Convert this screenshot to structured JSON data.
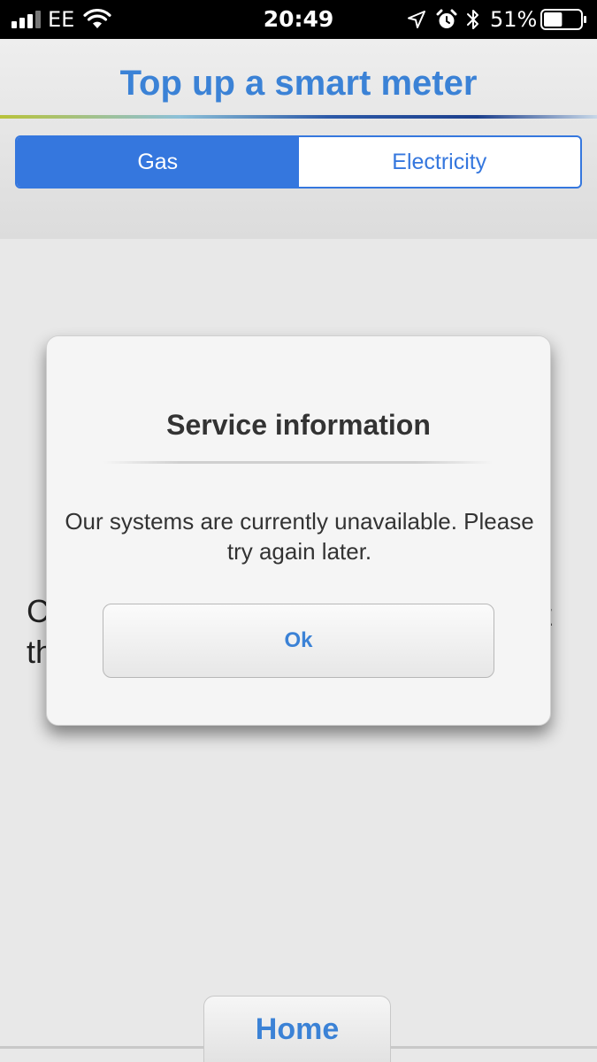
{
  "status_bar": {
    "carrier": "EE",
    "time": "20:49",
    "battery_percent": "51%",
    "battery_level": 0.51,
    "icons": [
      "signal-icon",
      "wifi-icon",
      "location-arrow-icon",
      "alarm-icon",
      "bluetooth-icon",
      "battery-icon"
    ]
  },
  "header": {
    "title": "Top up a smart meter"
  },
  "segmented_control": {
    "options": [
      {
        "label": "Gas",
        "selected": true
      },
      {
        "label": "Electricity",
        "selected": false
      }
    ]
  },
  "background_content": {
    "fragment_line1": "C",
    "fragment_line2": "th",
    "fragment_right": "t"
  },
  "dialog": {
    "title": "Service information",
    "message": "Our systems are currently unavailable. Please try again later.",
    "ok_label": "Ok"
  },
  "bottom_nav": {
    "home_label": "Home"
  },
  "colors": {
    "accent": "#3577de",
    "title_blue": "#3b82d6",
    "background": "#e8e8e8"
  }
}
